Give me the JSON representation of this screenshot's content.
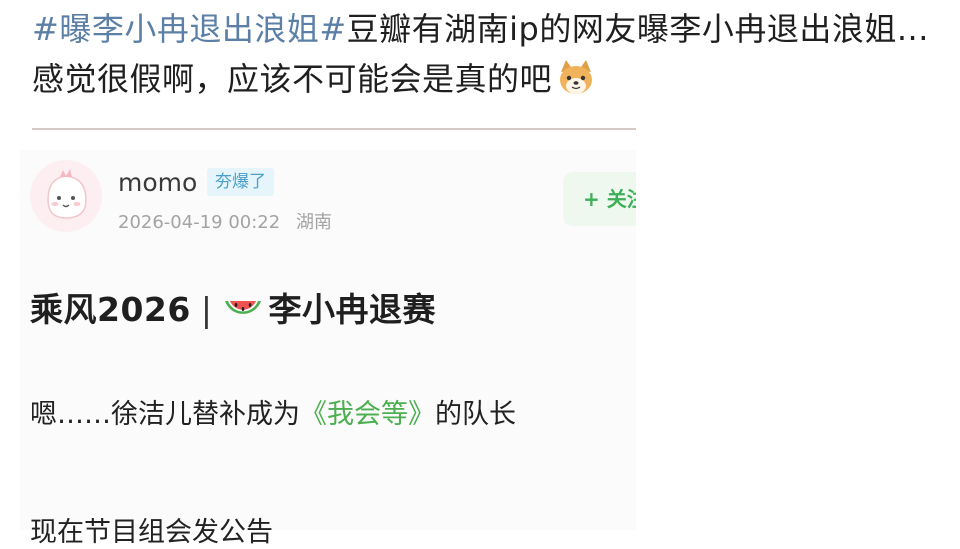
{
  "headline": {
    "hashtag_open": "#曝李小冉退出浪姐#",
    "text": "豆瓣有湖南ip的网友曝李小冉退出浪姐...感觉很假啊，应该不可能会是真的吧",
    "emoji": "dog-face-emoji"
  },
  "post": {
    "username": "momo",
    "badge": "夯爆了",
    "date": "2026-04-19 00:22",
    "location": "湖南",
    "follow_label": "+ 关注",
    "title_left": "乘风2026",
    "title_sep": "|",
    "title_right": "李小冉退赛",
    "line1_prefix": "嗯……徐洁儿替补成为",
    "line1_link": "《我会等》",
    "line1_suffix": "的队长",
    "line2": "现在节目组会发公告"
  },
  "colors": {
    "hashtag": "#5b7fa6",
    "badge_text": "#4a9fcb",
    "follow_green": "#3fae58",
    "link_green": "#4caf50"
  }
}
